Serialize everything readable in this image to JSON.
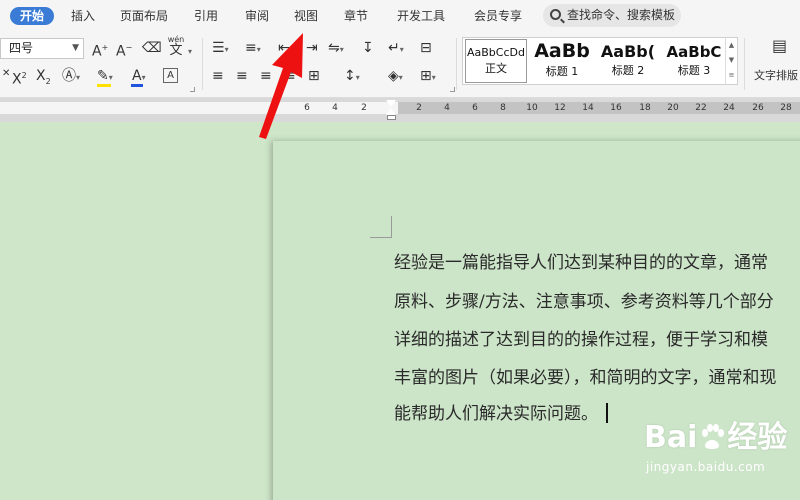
{
  "tabs": [
    {
      "label": "开始",
      "active": true
    },
    {
      "label": "插入"
    },
    {
      "label": "页面布局"
    },
    {
      "label": "引用"
    },
    {
      "label": "审阅"
    },
    {
      "label": "视图"
    },
    {
      "label": "章节"
    },
    {
      "label": "开发工具"
    },
    {
      "label": "会员专享"
    }
  ],
  "search": {
    "label": "查找命令、搜索模板"
  },
  "ribbon": {
    "font_size": "四号",
    "phonetic_label": "wén",
    "phonetic_char": "文",
    "styles": [
      {
        "sample": "AaBbCcDd",
        "label": "正文"
      },
      {
        "sample": "AaBb",
        "label": "标题 1"
      },
      {
        "sample": "AaBb(",
        "label": "标题 2"
      },
      {
        "sample": "AaBbC",
        "label": "标题 3"
      }
    ],
    "text_layout_label": "文字排版"
  },
  "ruler": {
    "ticks": [
      "6",
      "4",
      "2",
      "2",
      "4",
      "6",
      "8",
      "10",
      "12",
      "14",
      "16",
      "18",
      "20",
      "22",
      "24",
      "26",
      "28"
    ]
  },
  "document": {
    "lines": [
      "经验是一篇能指导人们达到某种目的的文章，通常",
      "原料、步骤/方法、注意事项、参考资料等几个部分",
      "详细的描述了达到目的的操作过程，便于学习和模",
      "丰富的图片（如果必要），和简明的文字，通常和现",
      "能帮助人们解决实际问题。"
    ]
  },
  "watermark": {
    "logo_left": "Bai",
    "logo_right": "经验",
    "url": "jingyan.baidu.com"
  },
  "colors": {
    "accent": "#3a7bd5",
    "page": "#cce5c8",
    "arrow": "#ee1111",
    "font_color_bar": "#2255dd",
    "highlight_bar": "#ffe000"
  }
}
